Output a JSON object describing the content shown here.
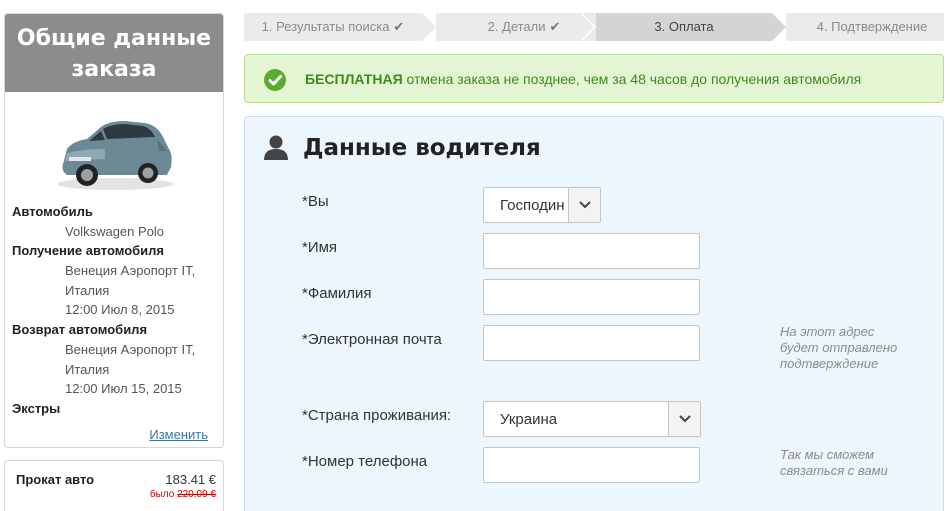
{
  "summary": {
    "title_line1": "Общие данные",
    "title_line2": "заказа",
    "car_label": "Автомобиль",
    "car_value": "Volkswagen Polo",
    "pickup_label": "Получение автомобиля",
    "pickup_location_line1": "Венеция Аэропорт IT,",
    "pickup_location_line2": "Италия",
    "pickup_datetime": "12:00 Июл 8, 2015",
    "return_label": "Возврат автомобиля",
    "return_location_line1": "Венеция Аэропорт IT,",
    "return_location_line2": "Италия",
    "return_datetime": "12:00 Июл 15, 2015",
    "extras_label": "Экстры",
    "change_link": "Изменить"
  },
  "price": {
    "label": "Прокат авто",
    "value": "183.41 €",
    "was_label": "было",
    "old_value": "220.09 €"
  },
  "steps": [
    {
      "label": "1. Результаты поиска",
      "done": true
    },
    {
      "label": "2. Детали",
      "done": true
    },
    {
      "label": "3. Оплата",
      "done": false
    },
    {
      "label": "4. Подтверждение",
      "done": false
    }
  ],
  "banner": {
    "bold": "БЕСПЛАТНАЯ",
    "text": " отмена заказа не позднее, чем за 48 часов до получения автомобиля"
  },
  "driver": {
    "title": "Данные водителя",
    "title_label": "*Вы",
    "title_value": "Господин",
    "first_name_label": "*Имя",
    "first_name_value": "",
    "last_name_label": "*Фамилия",
    "last_name_value": "",
    "email_label": "*Электронная почта",
    "email_value": "",
    "email_hint_line1": "На этот адрес",
    "email_hint_line2": "будет отправлено",
    "email_hint_line3": "подтверждение",
    "country_label": "*Страна проживания:",
    "country_value": "Украина",
    "phone_label": "*Номер телефона",
    "phone_value": "",
    "phone_hint_line1": "Так мы сможем",
    "phone_hint_line2": "связаться с вами"
  },
  "colors": {
    "sidebar_header": "#8c8c8c",
    "banner_bg": "#e4f5d3",
    "banner_text": "#3d8a1c",
    "panel_bg": "#eef6fd",
    "step_active": "#d4d4d4",
    "step_inactive": "#ebebeb"
  }
}
